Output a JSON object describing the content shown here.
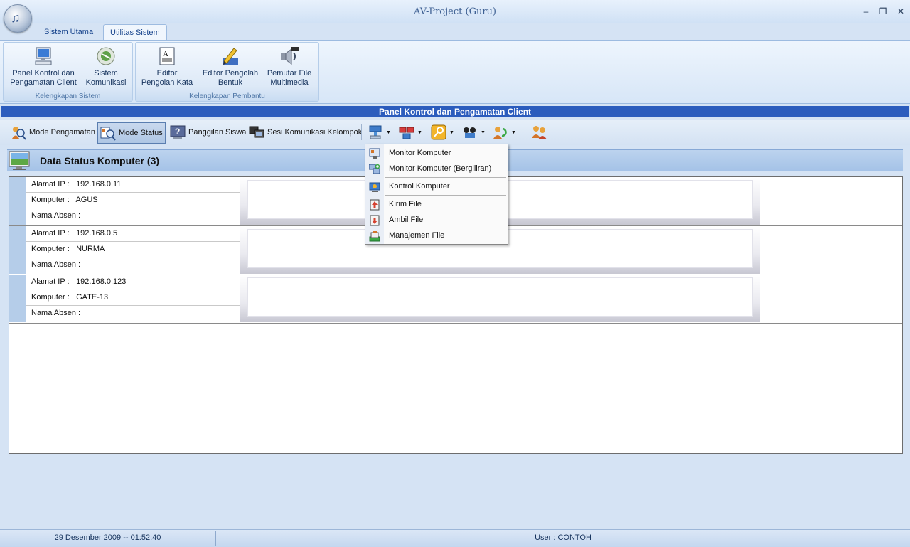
{
  "window": {
    "title": "AV-Project (Guru)",
    "minimize": "–",
    "restore": "❐",
    "close": "✕"
  },
  "ribbon_tabs": [
    "Sistem Utama",
    "Utilitas Sistem"
  ],
  "ribbon": {
    "groups": [
      {
        "label": "Kelengkapan Sistem",
        "buttons": [
          {
            "line1": "Panel Kontrol dan",
            "line2": "Pengamatan Client",
            "icon": "computer-monitor-icon"
          },
          {
            "line1": "Sistem",
            "line2": "Komunikasi",
            "icon": "communication-icon"
          }
        ]
      },
      {
        "label": "Kelengkapan Pembantu",
        "buttons": [
          {
            "line1": "Editor",
            "line2": "Pengolah Kata",
            "icon": "text-document-icon"
          },
          {
            "line1": "Editor Pengolah",
            "line2": "Bentuk",
            "icon": "drawing-pencil-icon"
          },
          {
            "line1": "Pemutar File",
            "line2": "Multimedia",
            "icon": "speaker-film-icon"
          }
        ]
      }
    ]
  },
  "panel_title": "Panel Kontrol dan Pengamatan Client",
  "toolbar": {
    "mode_pengamatan": "Mode Pengamatan",
    "mode_status": "Mode Status",
    "panggilan_siswa": "Panggilan Siswa",
    "sesi_komunikasi": "Sesi Komunikasi Kelompok"
  },
  "data_header": "Data Status Komputer (3)",
  "labels": {
    "ip": "Alamat IP :",
    "computer": "Komputer :",
    "absen": "Nama Absen :"
  },
  "computers": [
    {
      "ip": "192.168.0.11",
      "name": "AGUS",
      "absen": ""
    },
    {
      "ip": "192.168.0.5",
      "name": "NURMA",
      "absen": ""
    },
    {
      "ip": "192.168.0.123",
      "name": "GATE-13",
      "absen": ""
    }
  ],
  "menu": {
    "items": [
      {
        "label": "Monitor Komputer",
        "icon": "monitor-computer-icon"
      },
      {
        "label": "Monitor Komputer (Bergiliran)",
        "icon": "monitor-rotate-icon"
      },
      {
        "label": "Kontrol Komputer",
        "icon": "control-computer-icon"
      },
      {
        "label": "Kirim File",
        "icon": "send-file-icon"
      },
      {
        "label": "Ambil File",
        "icon": "get-file-icon"
      },
      {
        "label": "Manajemen File",
        "icon": "file-management-icon"
      }
    ]
  },
  "status": {
    "datetime": "29 Desember 2009 -- 01:52:40",
    "user": "User : CONTOH"
  }
}
